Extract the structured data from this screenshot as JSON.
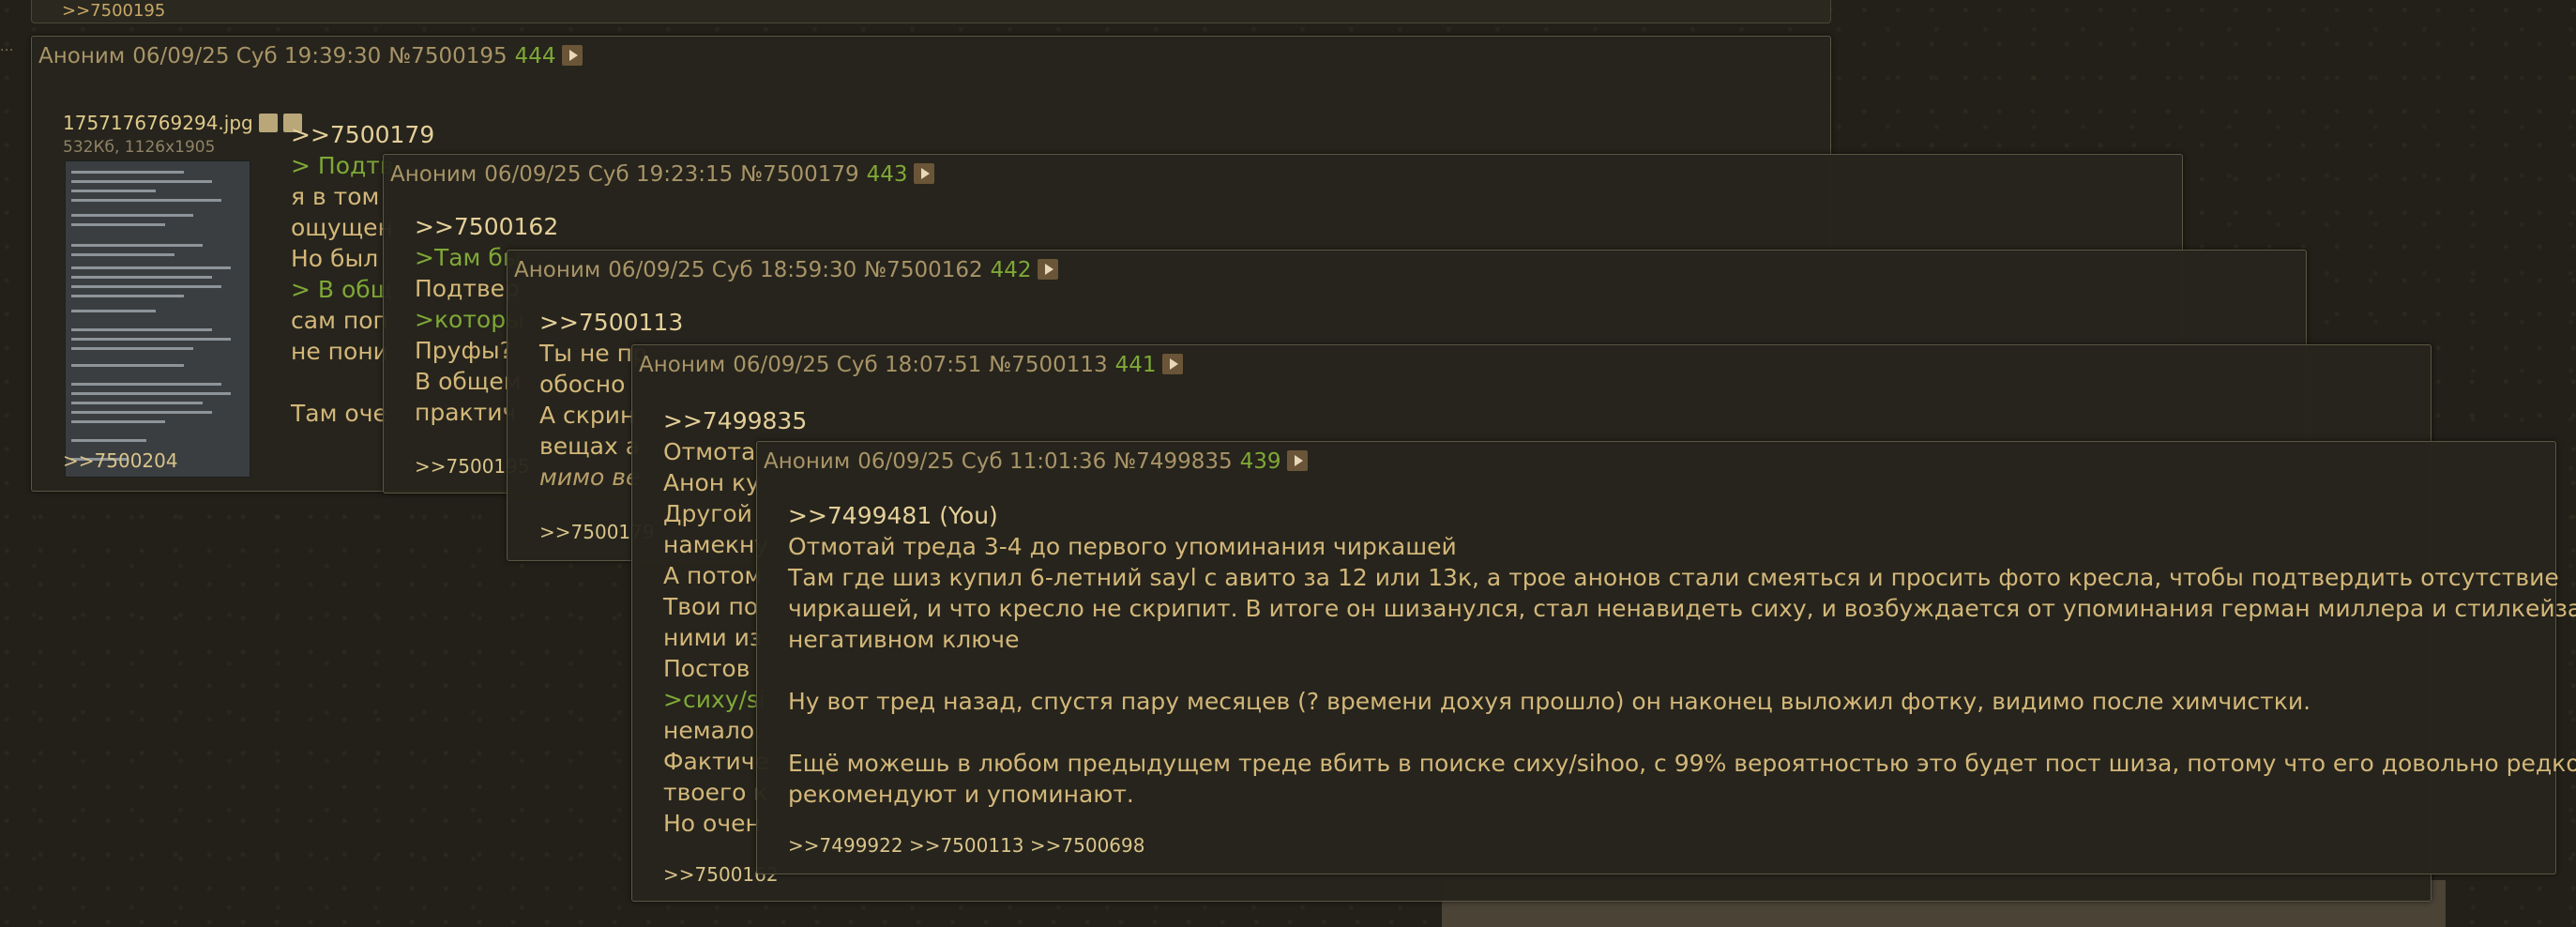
{
  "top_stub": {
    "reply_ref": ">>7500195"
  },
  "posts": [
    {
      "name": "Аноним",
      "date": "06/09/25 Суб 19:39:30",
      "num": "№7500195",
      "count": "444",
      "file": {
        "name": "1757176769294.jpg",
        "meta": "532Кб, 1126x1905"
      },
      "lines": [
        ">>7500179",
        "> Подтв",
        "я в том",
        "ощущен",
        "Но был",
        "> В общ",
        "сам поп",
        "не пони",
        "",
        "Там оче"
      ],
      "replies": ">>7500204"
    },
    {
      "name": "Аноним",
      "date": "06/09/25 Суб 19:23:15",
      "num": "№7500179",
      "count": "443",
      "lines": [
        ">>7500162",
        ">Там бы",
        "Подтвер",
        ">которы",
        "Пруфы?",
        "В общем",
        "практич"
      ],
      "replies": ">>7500195"
    },
    {
      "name": "Аноним",
      "date": "06/09/25 Суб 18:59:30",
      "num": "№7500162",
      "count": "442",
      "lines": [
        ">>7500113",
        "Ты не пр",
        "обосно",
        "А скрин",
        "вещах а",
        "мимо ве"
      ],
      "replies": ">>7500179"
    },
    {
      "name": "Аноним",
      "date": "06/09/25 Суб 18:07:51",
      "num": "№7500113",
      "count": "441",
      "lines": [
        ">>7499835",
        "Отмота",
        "Анон ку",
        "Другой",
        "намекну",
        "А потом",
        "Твои по",
        "ними из",
        "Постов",
        ">сиху/si",
        "немало.",
        "Фактиче",
        "твоего к",
        "Но очен"
      ],
      "replies": ">>7500162"
    },
    {
      "name": "Аноним",
      "date": "06/09/25 Суб 11:01:36",
      "num": "№7499835",
      "count": "439",
      "reply_to": ">>7499481",
      "you_mark": "(You)",
      "lines": [
        "Отмотай треда 3-4 до первого упоминания чиркашей",
        "Там где шиз купил 6-летний sayl с авито за 12 или 13к, а трое анонов стали смеяться и просить фото кресла, чтобы подтвердить отсутствие",
        "чиркашей, и что кресло не скрипит. В итоге он шизанулся, стал ненавидеть сиху, и возбуждается от упоминания герман миллера и стилкейза в",
        "негативном ключе",
        "",
        "Ну вот тред назад, спустя пару месяцев (? времени дохуя прошло) он наконец выложил фотку, видимо после химчистки.",
        "",
        "Ещё можешь в любом предыдущем треде вбить в поиске сиху/sihoo, с 99% вероятностью это будет пост шиза, потому что его довольно редко",
        "рекомендуют и упоминают."
      ],
      "replies": ">>7499922 >>7500113 >>7500698"
    }
  ]
}
